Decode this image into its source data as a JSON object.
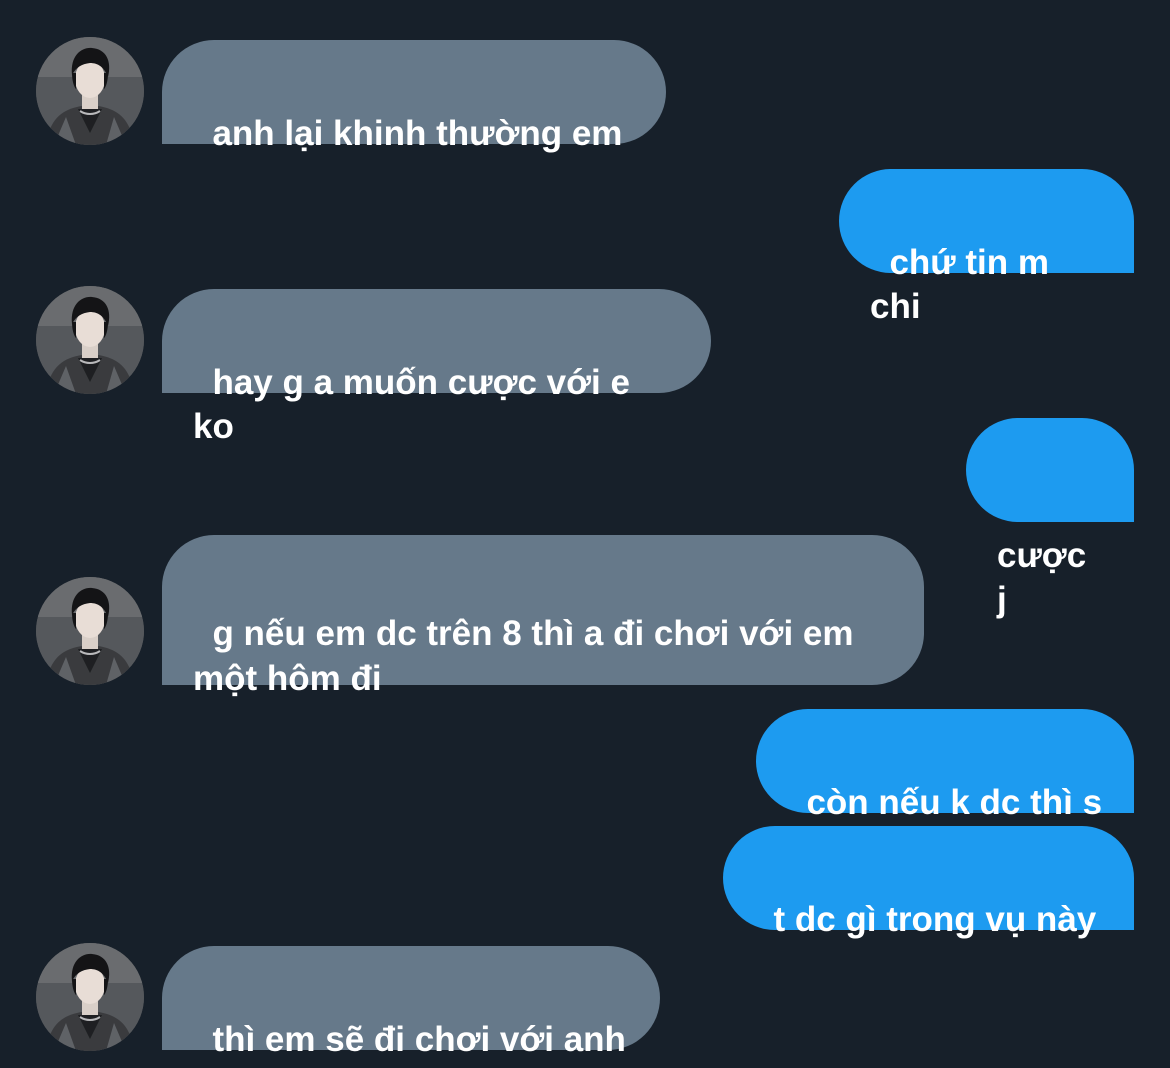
{
  "messages": [
    {
      "from": "other",
      "text": "anh lại khinh thường em"
    },
    {
      "from": "me",
      "text": "chứ tin m chi"
    },
    {
      "from": "other",
      "text": "hay g a muốn cược với e ko"
    },
    {
      "from": "me",
      "text": "cược j"
    },
    {
      "from": "other",
      "text": "g nếu em dc trên 8 thì a đi chơi với em một hôm đi"
    },
    {
      "from": "me",
      "text": "còn nếu k dc thì s"
    },
    {
      "from": "me",
      "text": "t dc gì trong vụ này"
    },
    {
      "from": "other",
      "text": "thì em sẽ đi chơi với anh"
    }
  ],
  "colors": {
    "background": "#17202a",
    "incoming_bubble": "#66798a",
    "outgoing_bubble": "#1d9bf0",
    "text": "#ffffff"
  }
}
